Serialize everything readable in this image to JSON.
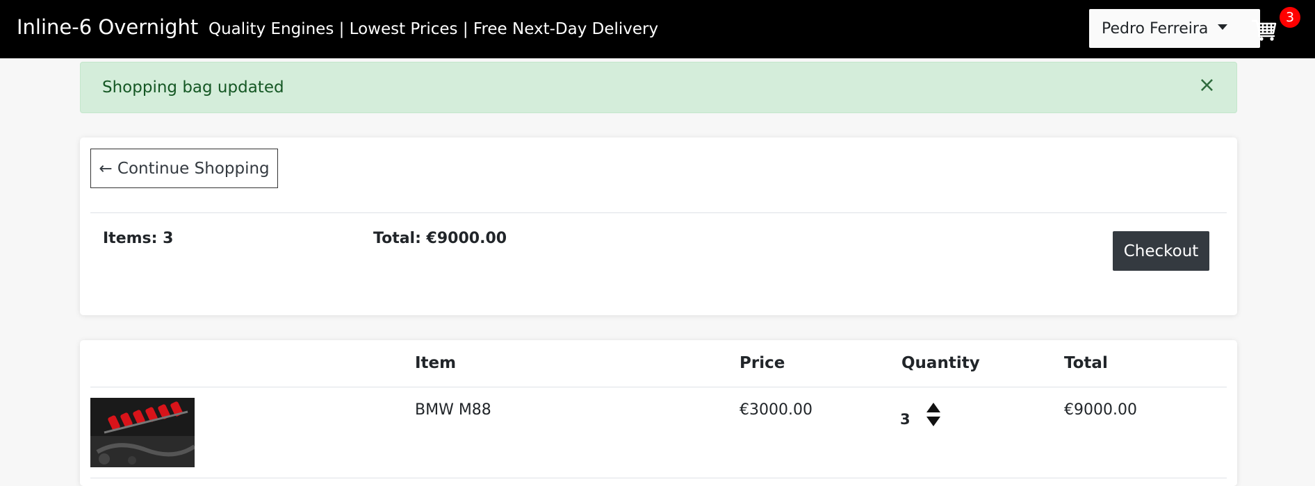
{
  "header": {
    "brand": "Inline-6 Overnight",
    "tagline": "Quality Engines | Lowest Prices | Free Next-Day Delivery",
    "user_name": "Pedro Ferreira",
    "cart_count": "3",
    "cart_icon": "shopping-cart-icon",
    "dropdown_icon": "caret-down-icon"
  },
  "alert": {
    "message": "Shopping bag updated",
    "close_symbol": "×"
  },
  "summary": {
    "continue_label": "← Continue Shopping",
    "items_label": "Items: 3",
    "total_label": "Total: €9000.00",
    "checkout_label": "Checkout"
  },
  "table": {
    "headers": {
      "item": "Item",
      "price": "Price",
      "quantity": "Quantity",
      "total": "Total"
    },
    "rows": [
      {
        "name": "BMW M88",
        "price": "€3000.00",
        "quantity": "3",
        "total": "€9000.00",
        "image": "engine-photo"
      }
    ]
  },
  "colors": {
    "header_bg": "#000000",
    "alert_bg": "#d4edda",
    "alert_text": "#155724",
    "checkout_bg": "#343a40",
    "badge": "#ff0000"
  }
}
